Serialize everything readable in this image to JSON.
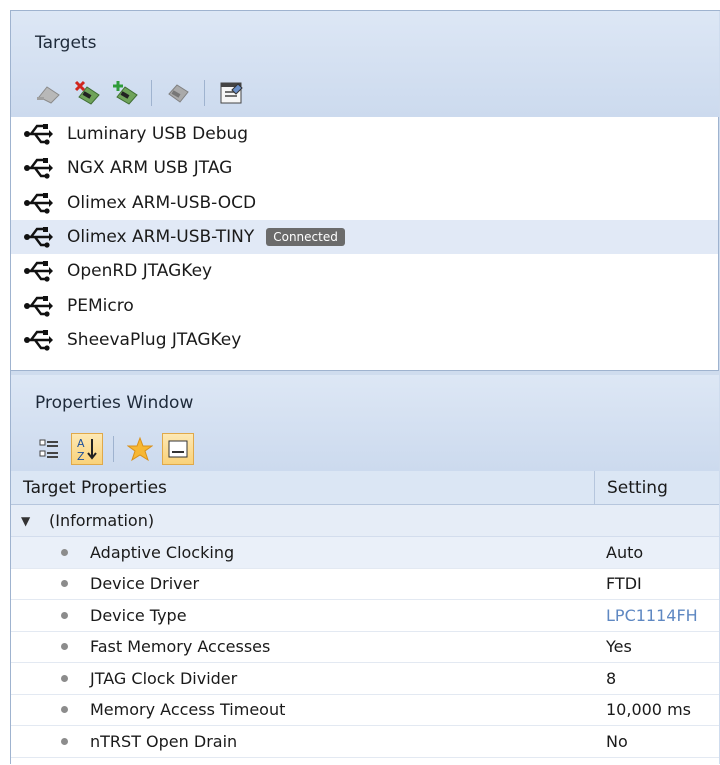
{
  "targets": {
    "title": "Targets",
    "toolbar": [
      {
        "icon": "connect-icon"
      },
      {
        "icon": "disconnect-icon"
      },
      {
        "icon": "new-target-icon"
      },
      {
        "icon": "reset-icon"
      },
      {
        "icon": "target-properties-icon"
      }
    ],
    "items": [
      {
        "label": "Luminary USB Debug",
        "status": ""
      },
      {
        "label": "NGX ARM USB JTAG",
        "status": ""
      },
      {
        "label": "Olimex ARM-USB-OCD",
        "status": ""
      },
      {
        "label": "Olimex ARM-USB-TINY",
        "status": "Connected"
      },
      {
        "label": "OpenRD JTAGKey",
        "status": ""
      },
      {
        "label": "PEMicro",
        "status": ""
      },
      {
        "label": "SheevaPlug JTAGKey",
        "status": ""
      }
    ]
  },
  "properties": {
    "title": "Properties Window",
    "toolbar": [
      {
        "icon": "categorized-icon"
      },
      {
        "icon": "sort-alphabetical-icon",
        "active": true
      },
      {
        "icon": "favorites-star-icon"
      },
      {
        "icon": "property-pages-icon",
        "active": true
      }
    ],
    "columns": {
      "property": "Target Properties",
      "setting": "Setting"
    },
    "group": "(Information)",
    "rows": [
      {
        "name": "Adaptive Clocking",
        "value": "Auto"
      },
      {
        "name": "Device Driver",
        "value": "FTDI"
      },
      {
        "name": "Device Type",
        "value": "LPC1114FH"
      },
      {
        "name": "Fast Memory Accesses",
        "value": "Yes"
      },
      {
        "name": "JTAG Clock Divider",
        "value": "8"
      },
      {
        "name": "Memory Access Timeout",
        "value": "10,000 ms"
      },
      {
        "name": "nTRST Open Drain",
        "value": "No"
      }
    ]
  },
  "colors": {
    "panel": "#cfdcee",
    "selected_row": "#e1e9f6",
    "badge": "#6b6b6b",
    "link_value": "#5f88c2"
  }
}
